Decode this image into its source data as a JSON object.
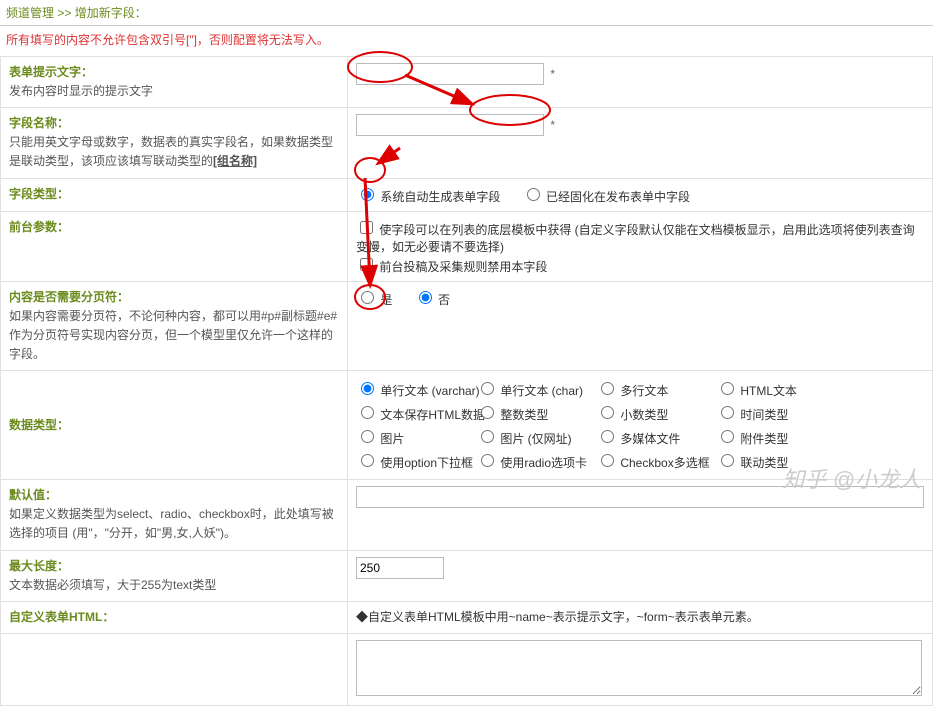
{
  "breadcrumb": {
    "root": "频道管理",
    "sep": " >> ",
    "current": "增加新字段："
  },
  "warning": "所有填写的内容不允许包含双引号[\"]，否则配置将无法写入。",
  "rows": {
    "tip": {
      "label": "表单提示文字：",
      "desc": "发布内容时显示的提示文字",
      "star": "*"
    },
    "name": {
      "label": "字段名称：",
      "desc1": "只能用英文字母或数字，数据表的真实字段名，如果数据类型是联动类型，该项应该填写联动类型的",
      "desc2": "[组名称]",
      "star": "*"
    },
    "ftype": {
      "label": "字段类型：",
      "opt1": "系统自动生成表单字段",
      "opt2": "已经固化在发布表单中字段"
    },
    "front": {
      "label": "前台参数：",
      "opt1_a": "使字段可以在列表的底层模板中获得 (自定义字段默认仅能在文档模板显示，启用此选项将使列表查询变慢，如无必要请不要选择)",
      "opt2": "前台投稿及采集规则禁用本字段"
    },
    "split": {
      "label": "内容是否需要分页符：",
      "desc": "如果内容需要分页符，不论何种内容，都可以用#p#副标题#e#作为分页符号实现内容分页，但一个模型里仅允许一个这样的字段。",
      "yes": "是",
      "no": "否"
    },
    "dtype": {
      "label": "数据类型：",
      "opts": [
        "单行文本 (varchar)",
        "单行文本 (char)",
        "多行文本",
        "HTML文本",
        "文本保存HTML数据",
        "整数类型",
        "小数类型",
        "时间类型",
        "图片",
        "图片 (仅网址)",
        "多媒体文件",
        "附件类型",
        "使用option下拉框",
        "使用radio选项卡",
        "Checkbox多选框",
        "联动类型"
      ]
    },
    "def": {
      "label": "默认值：",
      "desc": "如果定义数据类型为select、radio、checkbox时，此处填写被选择的项目 (用\"，\"分开，如\"男,女,人妖\")。"
    },
    "maxl": {
      "label": "最大长度：",
      "desc": "文本数据必须填写，大于255为text类型",
      "value": "250"
    },
    "chtml": {
      "label": "自定义表单HTML：",
      "note": "◆自定义表单HTML模板中用~name~表示提示文字，~form~表示表单元素。"
    }
  },
  "watermark": "知乎 @小龙人"
}
